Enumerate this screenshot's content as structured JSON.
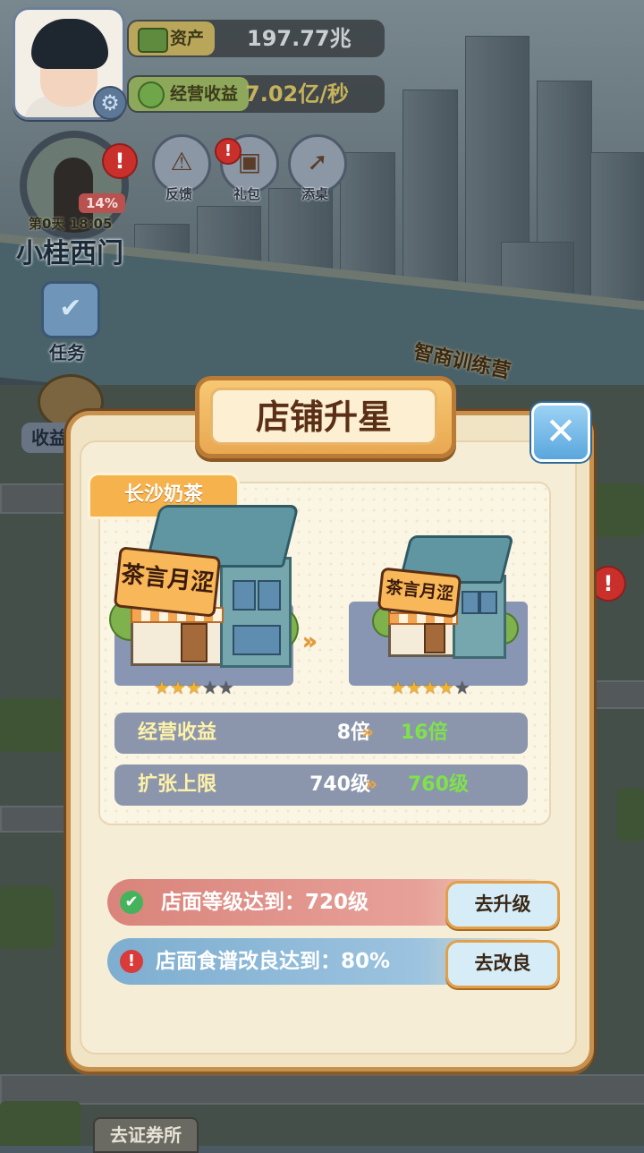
{
  "hud": {
    "assets_label": "资产",
    "assets_value": "197.77兆",
    "income_label": "经营收益",
    "income_value": "7.02亿/秒",
    "progress_percent": "14%",
    "day_time": "第0天  18:05",
    "location_name": "小桂西门",
    "buttons": {
      "feedback": "反馈",
      "gift": "礼包",
      "add_desktop": "添桌"
    },
    "task_label": "任务",
    "income_side_label": "收益",
    "notice_badge": "!"
  },
  "background": {
    "training_sign": "智商训练营",
    "exchange_sign": "去证券所"
  },
  "modal": {
    "title": "店铺升星",
    "close_glyph": "✕",
    "shop_tag": "长沙奶茶",
    "shop_board": "茶言月涩",
    "current_stars": 3,
    "next_stars": 4,
    "total_stars": 5,
    "stats": [
      {
        "label": "经营收益",
        "from": "8倍",
        "to": "16倍"
      },
      {
        "label": "扩张上限",
        "from": "740级",
        "to": "760级"
      }
    ],
    "requirements": [
      {
        "status": "done",
        "text": "店面等级达到：720级",
        "button": "去升级"
      },
      {
        "status": "pending",
        "text": "店面食谱改良达到：80%",
        "button": "去改良"
      }
    ]
  },
  "colors": {
    "panel_bg": "#f1e4c4",
    "panel_border": "#c7904c",
    "accent_orange": "#f5b24d",
    "value_green": "#7fe24a",
    "req_done_bg": "#d9847b",
    "req_pending_bg": "#7eaed0"
  }
}
